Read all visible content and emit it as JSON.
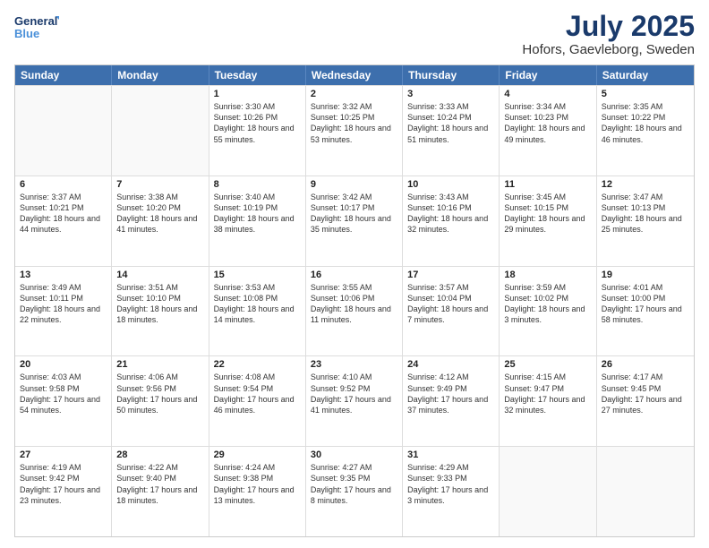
{
  "header": {
    "logo_line1": "General",
    "logo_line2": "Blue",
    "month": "July 2025",
    "location": "Hofors, Gaevleborg, Sweden"
  },
  "days_of_week": [
    "Sunday",
    "Monday",
    "Tuesday",
    "Wednesday",
    "Thursday",
    "Friday",
    "Saturday"
  ],
  "weeks": [
    [
      {
        "day": "",
        "empty": true
      },
      {
        "day": "",
        "empty": true
      },
      {
        "day": "1",
        "sunrise": "3:30 AM",
        "sunset": "10:26 PM",
        "daylight": "18 hours and 55 minutes."
      },
      {
        "day": "2",
        "sunrise": "3:32 AM",
        "sunset": "10:25 PM",
        "daylight": "18 hours and 53 minutes."
      },
      {
        "day": "3",
        "sunrise": "3:33 AM",
        "sunset": "10:24 PM",
        "daylight": "18 hours and 51 minutes."
      },
      {
        "day": "4",
        "sunrise": "3:34 AM",
        "sunset": "10:23 PM",
        "daylight": "18 hours and 49 minutes."
      },
      {
        "day": "5",
        "sunrise": "3:35 AM",
        "sunset": "10:22 PM",
        "daylight": "18 hours and 46 minutes."
      }
    ],
    [
      {
        "day": "6",
        "sunrise": "3:37 AM",
        "sunset": "10:21 PM",
        "daylight": "18 hours and 44 minutes."
      },
      {
        "day": "7",
        "sunrise": "3:38 AM",
        "sunset": "10:20 PM",
        "daylight": "18 hours and 41 minutes."
      },
      {
        "day": "8",
        "sunrise": "3:40 AM",
        "sunset": "10:19 PM",
        "daylight": "18 hours and 38 minutes."
      },
      {
        "day": "9",
        "sunrise": "3:42 AM",
        "sunset": "10:17 PM",
        "daylight": "18 hours and 35 minutes."
      },
      {
        "day": "10",
        "sunrise": "3:43 AM",
        "sunset": "10:16 PM",
        "daylight": "18 hours and 32 minutes."
      },
      {
        "day": "11",
        "sunrise": "3:45 AM",
        "sunset": "10:15 PM",
        "daylight": "18 hours and 29 minutes."
      },
      {
        "day": "12",
        "sunrise": "3:47 AM",
        "sunset": "10:13 PM",
        "daylight": "18 hours and 25 minutes."
      }
    ],
    [
      {
        "day": "13",
        "sunrise": "3:49 AM",
        "sunset": "10:11 PM",
        "daylight": "18 hours and 22 minutes."
      },
      {
        "day": "14",
        "sunrise": "3:51 AM",
        "sunset": "10:10 PM",
        "daylight": "18 hours and 18 minutes."
      },
      {
        "day": "15",
        "sunrise": "3:53 AM",
        "sunset": "10:08 PM",
        "daylight": "18 hours and 14 minutes."
      },
      {
        "day": "16",
        "sunrise": "3:55 AM",
        "sunset": "10:06 PM",
        "daylight": "18 hours and 11 minutes."
      },
      {
        "day": "17",
        "sunrise": "3:57 AM",
        "sunset": "10:04 PM",
        "daylight": "18 hours and 7 minutes."
      },
      {
        "day": "18",
        "sunrise": "3:59 AM",
        "sunset": "10:02 PM",
        "daylight": "18 hours and 3 minutes."
      },
      {
        "day": "19",
        "sunrise": "4:01 AM",
        "sunset": "10:00 PM",
        "daylight": "17 hours and 58 minutes."
      }
    ],
    [
      {
        "day": "20",
        "sunrise": "4:03 AM",
        "sunset": "9:58 PM",
        "daylight": "17 hours and 54 minutes."
      },
      {
        "day": "21",
        "sunrise": "4:06 AM",
        "sunset": "9:56 PM",
        "daylight": "17 hours and 50 minutes."
      },
      {
        "day": "22",
        "sunrise": "4:08 AM",
        "sunset": "9:54 PM",
        "daylight": "17 hours and 46 minutes."
      },
      {
        "day": "23",
        "sunrise": "4:10 AM",
        "sunset": "9:52 PM",
        "daylight": "17 hours and 41 minutes."
      },
      {
        "day": "24",
        "sunrise": "4:12 AM",
        "sunset": "9:49 PM",
        "daylight": "17 hours and 37 minutes."
      },
      {
        "day": "25",
        "sunrise": "4:15 AM",
        "sunset": "9:47 PM",
        "daylight": "17 hours and 32 minutes."
      },
      {
        "day": "26",
        "sunrise": "4:17 AM",
        "sunset": "9:45 PM",
        "daylight": "17 hours and 27 minutes."
      }
    ],
    [
      {
        "day": "27",
        "sunrise": "4:19 AM",
        "sunset": "9:42 PM",
        "daylight": "17 hours and 23 minutes."
      },
      {
        "day": "28",
        "sunrise": "4:22 AM",
        "sunset": "9:40 PM",
        "daylight": "17 hours and 18 minutes."
      },
      {
        "day": "29",
        "sunrise": "4:24 AM",
        "sunset": "9:38 PM",
        "daylight": "17 hours and 13 minutes."
      },
      {
        "day": "30",
        "sunrise": "4:27 AM",
        "sunset": "9:35 PM",
        "daylight": "17 hours and 8 minutes."
      },
      {
        "day": "31",
        "sunrise": "4:29 AM",
        "sunset": "9:33 PM",
        "daylight": "17 hours and 3 minutes."
      },
      {
        "day": "",
        "empty": true
      },
      {
        "day": "",
        "empty": true
      }
    ]
  ]
}
